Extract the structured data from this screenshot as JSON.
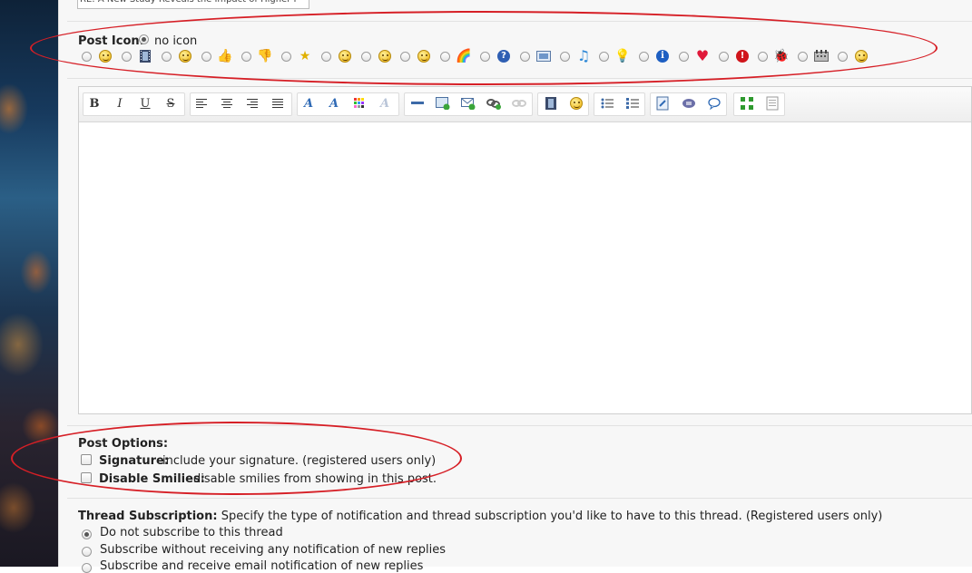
{
  "subject": {
    "value": "RE: A New Study Reveals the Impact of Higher I"
  },
  "post_icon": {
    "label": "Post Icon:",
    "no_icon_label": "no icon",
    "icons": [
      "smiley-icon",
      "film-icon",
      "smiley-icon",
      "thumbs-up-icon",
      "thumbs-down-icon",
      "star-icon",
      "smiley-icon",
      "smiley-icon",
      "smiley-icon",
      "rainbow-icon",
      "question-icon",
      "picture-icon",
      "music-note-icon",
      "lightbulb-icon",
      "info-icon",
      "heart-icon",
      "exclamation-icon",
      "bug-icon",
      "calendar-icon",
      "grin-icon"
    ],
    "icon_glyphs": {
      "thumbs": "👍",
      "thumbsdown": "👎",
      "star": "★",
      "rainbow": "🌈",
      "question": "?",
      "music": "♫",
      "bulb": "💡",
      "info": "i",
      "heart": "♥",
      "excl": "!",
      "bug": "🐞"
    }
  },
  "editor": {
    "toolbar": {
      "bold": "B",
      "italic": "I",
      "underline": "U",
      "strike": "S",
      "font": "A",
      "size": "A",
      "color_icon": "color-palette-icon",
      "clear_icon": "clear-format-icon"
    },
    "content": ""
  },
  "post_options": {
    "label": "Post Options:",
    "signature": {
      "label": "Signature:",
      "desc": "include your signature. (registered users only)"
    },
    "disable_smilies": {
      "label": "Disable Smilies:",
      "desc": "disable smilies from showing in this post."
    }
  },
  "thread_subscription": {
    "label": "Thread Subscription:",
    "desc": "Specify the type of notification and thread subscription you'd like to have to this thread. (Registered users only)",
    "options": [
      "Do not subscribe to this thread",
      "Subscribe without receiving any notification of new replies",
      "Subscribe and receive email notification of new replies"
    ]
  },
  "colors": {
    "highlight": "#d61f26"
  }
}
